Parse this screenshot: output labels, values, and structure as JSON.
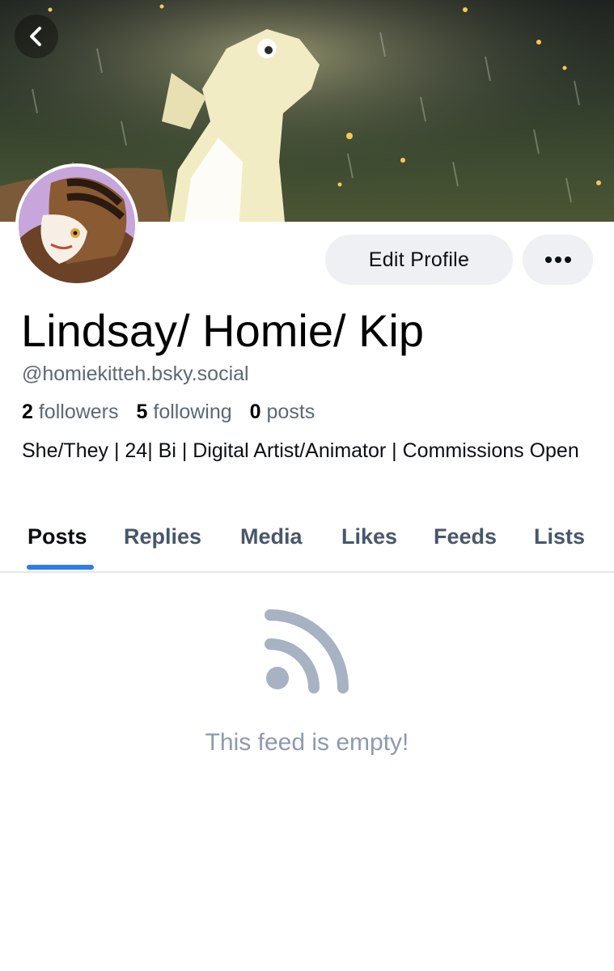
{
  "profile": {
    "display_name": "Lindsay/ Homie/ Kip",
    "handle": "@homiekitteh.bsky.social",
    "bio": "She/They | 24| Bi | Digital Artist/Animator | Commissions Open",
    "stats": {
      "followers_count": "2",
      "followers_label": "followers",
      "following_count": "5",
      "following_label": "following",
      "posts_count": "0",
      "posts_label": "posts"
    }
  },
  "actions": {
    "edit_profile_label": "Edit Profile",
    "more_icon": "ellipsis-icon",
    "back_icon": "chevron-left-icon"
  },
  "tabs": [
    {
      "label": "Posts",
      "active": true
    },
    {
      "label": "Replies",
      "active": false
    },
    {
      "label": "Media",
      "active": false
    },
    {
      "label": "Likes",
      "active": false
    },
    {
      "label": "Feeds",
      "active": false
    },
    {
      "label": "Lists",
      "active": false
    }
  ],
  "feed": {
    "empty_message": "This feed is empty!",
    "empty_icon": "rss-feed-icon"
  },
  "colors": {
    "accent": "#2f7bea",
    "muted_text": "#5b6877",
    "empty_text": "#8d9aae",
    "button_bg": "#eef0f3"
  }
}
